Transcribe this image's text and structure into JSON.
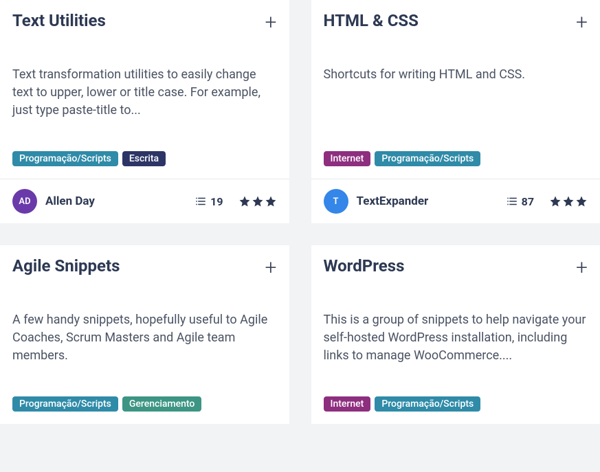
{
  "cards": [
    {
      "title": "Text Utilities",
      "description": "Text transformation utilities to easily change text to upper, lower or title case. For example, just type paste-title to...",
      "tags": [
        {
          "label": "Programação/Scripts",
          "color": "teal"
        },
        {
          "label": "Escrita",
          "color": "navy"
        }
      ],
      "author": {
        "initials": "AD",
        "name": "Allen Day",
        "avatarColor": "purple"
      },
      "count": "19",
      "stars": 3
    },
    {
      "title": "HTML & CSS",
      "description": "Shortcuts for writing HTML and CSS.",
      "tags": [
        {
          "label": "Internet",
          "color": "purple"
        },
        {
          "label": "Programação/Scripts",
          "color": "teal"
        }
      ],
      "author": {
        "initials": "T",
        "name": "TextExpander",
        "avatarColor": "blue"
      },
      "count": "87",
      "stars": 3
    },
    {
      "title": "Agile Snippets",
      "description": "A few handy snippets, hopefully useful to Agile Coaches, Scrum Masters and Agile team members.",
      "tags": [
        {
          "label": "Programação/Scripts",
          "color": "teal"
        },
        {
          "label": "Gerenciamento",
          "color": "green"
        }
      ],
      "author": null,
      "count": null,
      "stars": null
    },
    {
      "title": "WordPress",
      "description": "This is a group of snippets to help navigate your self-hosted WordPress installation, including links to manage WooCommerce....",
      "tags": [
        {
          "label": "Internet",
          "color": "purple"
        },
        {
          "label": "Programação/Scripts",
          "color": "teal"
        }
      ],
      "author": null,
      "count": null,
      "stars": null
    }
  ]
}
